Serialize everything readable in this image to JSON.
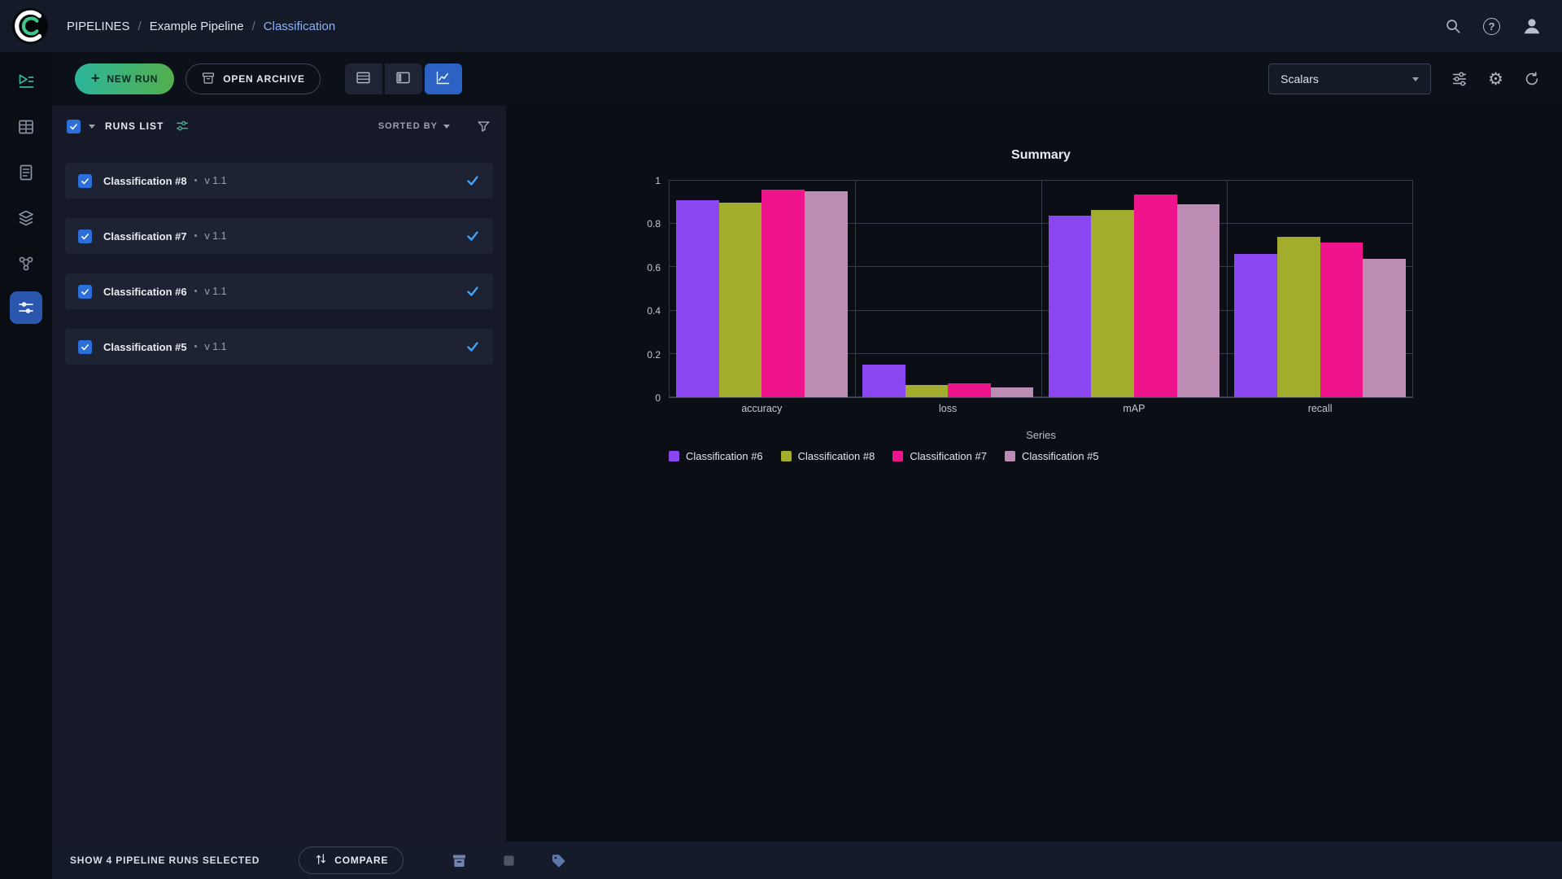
{
  "header": {
    "breadcrumb": [
      "PIPELINES",
      "Example Pipeline",
      "Classification"
    ],
    "icons": [
      "search-icon",
      "help-icon",
      "user-avatar-icon"
    ]
  },
  "sidebar": {
    "items": [
      {
        "id": "projects",
        "icon": "projects-icon",
        "active": false,
        "tint": "#3ab39d"
      },
      {
        "id": "datasets",
        "icon": "datasets-icon",
        "active": false
      },
      {
        "id": "reports",
        "icon": "reports-icon",
        "active": false
      },
      {
        "id": "models",
        "icon": "models-icon",
        "active": false
      },
      {
        "id": "workers",
        "icon": "workers-icon",
        "active": false
      },
      {
        "id": "pipelines",
        "icon": "pipelines-icon",
        "active": true
      }
    ]
  },
  "toolbar": {
    "new_run_label": "NEW RUN",
    "open_archive_label": "OPEN ARCHIVE",
    "view_toggles": [
      "table-view-icon",
      "split-view-icon",
      "scalars-view-icon"
    ],
    "active_view": "scalars-view-icon",
    "metric_select_value": "Scalars",
    "right_icons": [
      "tune-icon",
      "settings-gear-icon",
      "refresh-icon"
    ]
  },
  "runs_panel": {
    "title": "RUNS LIST",
    "sorted_by_label": "SORTED BY",
    "runs": [
      {
        "name": "Classification #8",
        "version": "v 1.1",
        "checked": true,
        "selected": true
      },
      {
        "name": "Classification #7",
        "version": "v 1.1",
        "checked": true,
        "selected": true
      },
      {
        "name": "Classification #6",
        "version": "v 1.1",
        "checked": true,
        "selected": true
      },
      {
        "name": "Classification #5",
        "version": "v 1.1",
        "checked": true,
        "selected": true
      }
    ]
  },
  "footer": {
    "selected_text": "SHOW 4 PIPELINE RUNS SELECTED",
    "compare_label": "COMPARE",
    "icons": [
      "archive-action-icon",
      "abort-action-icon",
      "tags-action-icon"
    ]
  },
  "chart_data": {
    "type": "bar",
    "title": "Summary",
    "legend_title": "Series",
    "categories": [
      "accuracy",
      "loss",
      "mAP",
      "recall"
    ],
    "series": [
      {
        "name": "Classification #6",
        "color": "#8a46f0",
        "values": [
          0.91,
          0.15,
          0.84,
          0.66
        ]
      },
      {
        "name": "Classification #8",
        "color": "#a2ad2d",
        "values": [
          0.9,
          0.055,
          0.865,
          0.74
        ]
      },
      {
        "name": "Classification #7",
        "color": "#f0148c",
        "values": [
          0.96,
          0.065,
          0.935,
          0.715
        ]
      },
      {
        "name": "Classification #5",
        "color": "#bd8cb5",
        "values": [
          0.95,
          0.045,
          0.89,
          0.64
        ]
      }
    ],
    "ylim": [
      0,
      1
    ],
    "yticks": [
      0,
      0.2,
      0.4,
      0.6,
      0.8,
      1
    ],
    "grid": true,
    "legend_position": "bottom"
  },
  "colors": {
    "accent_green": "#2bb59b",
    "accent_blue": "#2c62c4",
    "checkbox_blue": "#2d6fd9",
    "selected_check": "#45a2f5",
    "breadcrumb_current": "#8ab3f7"
  }
}
